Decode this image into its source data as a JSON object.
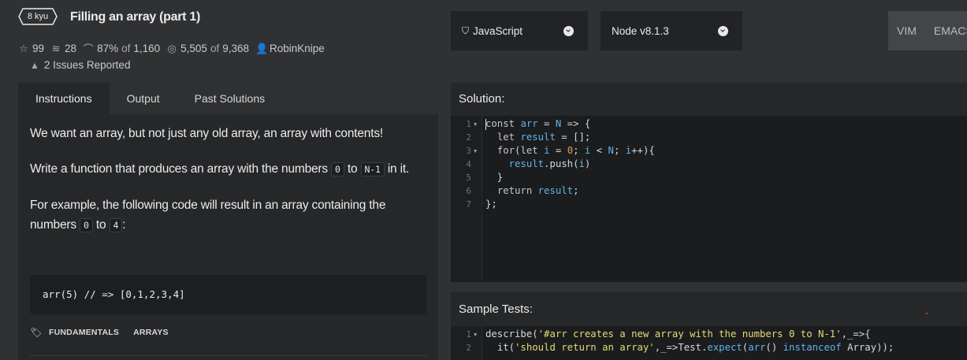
{
  "kata": {
    "rank": "8 kyu",
    "title": "Filling an array (part 1)",
    "stars": "99",
    "collections": "28",
    "satisfaction": "87%",
    "of_word": "of",
    "votes": "1,160",
    "completed": "5,505",
    "attempted": "9,368",
    "author": "RobinKnipe",
    "issues": "2 Issues Reported"
  },
  "language_select": {
    "value": "JavaScript",
    "icon": "js-shield-icon"
  },
  "runtime_select": {
    "value": "Node v8.1.3"
  },
  "editor_modes": [
    "VIM",
    "EMACS"
  ],
  "tabs": [
    "Instructions",
    "Output",
    "Past Solutions"
  ],
  "instructions": {
    "p1": "We want an array, but not just any old array, an array with contents!",
    "p2_a": "Write a function that produces an array with the numbers",
    "p2_code1": "0",
    "p2_to": "to",
    "p2_code2": "N-1",
    "p2_b": "in it.",
    "p3_a": "For example, the following code will result in an array containing the numbers",
    "p3_code1": "0",
    "p3_to": "to",
    "p3_code2": "4",
    "p3_colon": ":",
    "code_example": "arr(5) // => [0,1,2,3,4]"
  },
  "tags": [
    "FUNDAMENTALS",
    "ARRAYS"
  ],
  "solution": {
    "title": "Solution:",
    "line_numbers": [
      "1",
      "2",
      "3",
      "4",
      "5",
      "6",
      "7"
    ]
  },
  "sample_tests": {
    "title": "Sample Tests:",
    "line_numbers": [
      "1",
      "2"
    ]
  }
}
